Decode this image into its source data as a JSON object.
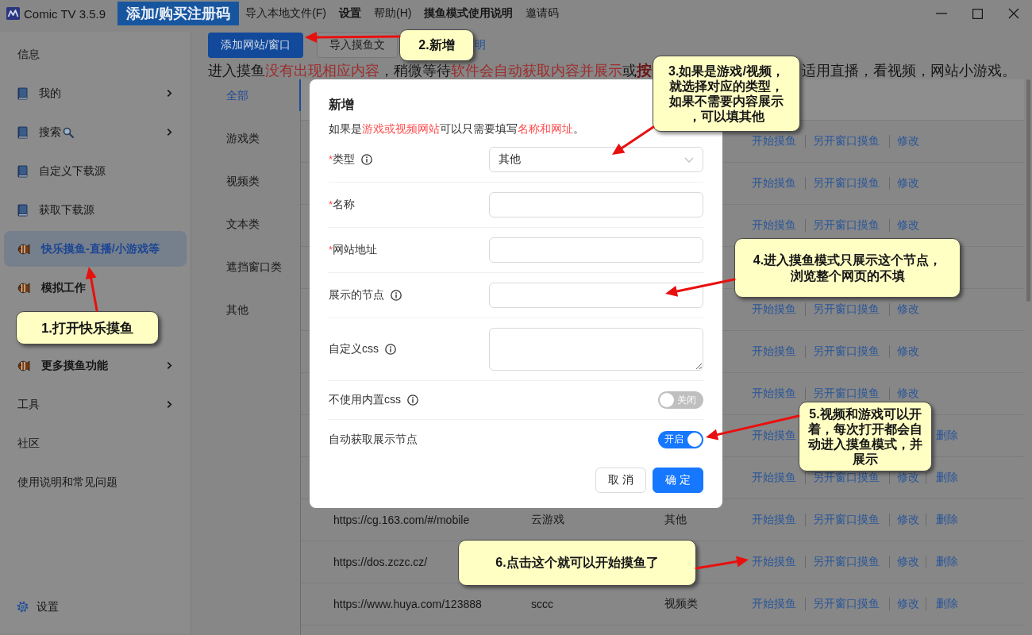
{
  "window": {
    "title": "Comic TV 3.5.9",
    "menu": [
      {
        "label": "添加/购买注册码",
        "highlighted": true,
        "bold": true
      },
      {
        "label": "导入本地文件(F)",
        "highlighted": false,
        "bold": false
      },
      {
        "label": "设置",
        "highlighted": false,
        "bold": true
      },
      {
        "label": "帮助(H)",
        "highlighted": false,
        "bold": false
      },
      {
        "label": "摸鱼模式使用说明",
        "highlighted": false,
        "bold": true
      },
      {
        "label": "邀请码",
        "highlighted": false,
        "bold": false
      }
    ]
  },
  "sidebar": {
    "items": [
      {
        "label": "信息",
        "submenu": false,
        "selected": false
      },
      {
        "label": "我的",
        "submenu": true,
        "selected": false
      },
      {
        "label": "搜索",
        "submenu": true,
        "selected": false
      },
      {
        "label": "自定义下载源",
        "submenu": false,
        "selected": false
      },
      {
        "label": "获取下载源",
        "submenu": false,
        "selected": false
      },
      {
        "label": "快乐摸鱼-直播/小游戏等",
        "submenu": false,
        "selected": true
      },
      {
        "label": "模拟工作",
        "submenu": false,
        "selected": false
      }
    ],
    "lower_items": [
      {
        "label": "更多摸鱼功能",
        "submenu": true,
        "selected": false
      },
      {
        "label": "工具",
        "submenu": true,
        "selected": false
      },
      {
        "label": "社区",
        "submenu": false,
        "selected": false
      },
      {
        "label": "使用说明和常见问题",
        "submenu": false,
        "selected": false
      }
    ],
    "footer": {
      "label": "设置"
    }
  },
  "toolbar": {
    "add_button": "添加网站/窗口",
    "import_button": "导入摸鱼文",
    "help_link": "明"
  },
  "notice": {
    "segments": [
      {
        "text": "进入摸鱼",
        "kind": "plain"
      },
      {
        "text": "没有出现相应内容",
        "kind": "alert"
      },
      {
        "text": "，稍微等待",
        "kind": "plain"
      },
      {
        "text": "软件会自动获取内容并展示",
        "kind": "alert"
      },
      {
        "text": "或",
        "kind": "plain"
      },
      {
        "text": "按",
        "kind": "strong"
      }
    ],
    "tail": "适用直播，看视频，网站小游戏。"
  },
  "categories": [
    {
      "label": "全部",
      "selected": true
    },
    {
      "label": "游戏类",
      "selected": false
    },
    {
      "label": "视频类",
      "selected": false
    },
    {
      "label": "文本类",
      "selected": false
    },
    {
      "label": "遮挡窗口类",
      "selected": false
    },
    {
      "label": "其他",
      "selected": false
    }
  ],
  "table": {
    "rows": [
      {
        "start_action": "开始摸鱼",
        "window_action": "另开窗口摸鱼",
        "edit_action": "修改"
      },
      {
        "start_action": "开始摸鱼",
        "window_action": "另开窗口摸鱼",
        "edit_action": "修改"
      },
      {
        "start_action": "开始摸鱼",
        "window_action": "另开窗口摸鱼",
        "edit_action": "修改"
      },
      {},
      {
        "start_action": "开始摸鱼",
        "window_action": "另开窗口摸鱼",
        "edit_action": "修改"
      },
      {
        "start_action": "开始摸鱼",
        "window_action": "另开窗口摸鱼",
        "edit_action": "修改"
      },
      {
        "start_action": "开始摸鱼",
        "window_action": "另开窗口摸鱼",
        "edit_action": "修改"
      },
      {
        "start_action": "开始摸鱼",
        "delete_action": "删除"
      },
      {
        "start_action": "开始摸鱼",
        "window_action": "另开窗口摸鱼",
        "edit_action": "修改",
        "delete_action": "删除"
      },
      {
        "url": "https://cg.163.com/#/mobile",
        "name": "云游戏",
        "type": "其他",
        "start_action": "开始摸鱼",
        "window_action": "另开窗口摸鱼",
        "edit_action": "修改",
        "delete_action": "删除"
      },
      {
        "url": "https://dos.zczc.cz/",
        "start_action": "开始摸鱼",
        "window_action": "另开窗口摸鱼",
        "edit_action": "修改",
        "delete_action": "删除"
      },
      {
        "url": "https://www.huya.com/123888",
        "name": "sccc",
        "type": "视频类",
        "start_action": "开始摸鱼",
        "window_action": "另开窗口摸鱼",
        "edit_action": "修改",
        "delete_action": "删除"
      }
    ]
  },
  "dialog": {
    "title": "新增",
    "hint": [
      {
        "text": "如果是",
        "kind": "plain"
      },
      {
        "text": "游戏或视频网站",
        "kind": "alert"
      },
      {
        "text": "可以只需要填写",
        "kind": "plain"
      },
      {
        "text": "名称和网址",
        "kind": "alert"
      },
      {
        "text": "。",
        "kind": "plain"
      }
    ],
    "fields": [
      {
        "kind": "select",
        "label": "类型",
        "required_mark": "*",
        "info": true,
        "value": "其他"
      },
      {
        "kind": "input",
        "label": "名称",
        "required_mark": "*",
        "info": false
      },
      {
        "kind": "input",
        "label": "网站地址",
        "required_mark": "*",
        "info": false
      },
      {
        "kind": "input",
        "label": "展示的节点",
        "info": true
      },
      {
        "kind": "textarea",
        "label": "自定义css",
        "info": true
      },
      {
        "kind": "switch",
        "label": "不使用内置css",
        "info": true,
        "on": false,
        "text": "关闭"
      },
      {
        "kind": "switch",
        "label": "自动获取展示节点",
        "info": false,
        "on": true,
        "text": "开启"
      }
    ],
    "buttons": [
      {
        "label": "取 消",
        "kind": "secondary"
      },
      {
        "label": "确 定",
        "kind": "primary"
      }
    ]
  },
  "callouts": [
    "1.打开快乐摸鱼",
    "2.新增",
    "3.如果是游戏/视频，就选择对应的类型，如果不需要内容展示，可以填其他",
    "4.进入摸鱼模式只展示这个节点，浏览整个网页的不填",
    "5.视频和游戏可以开着，每次打开都会自动进入摸鱼模式，并展示",
    "6.点击这个就可以开始摸鱼了"
  ]
}
